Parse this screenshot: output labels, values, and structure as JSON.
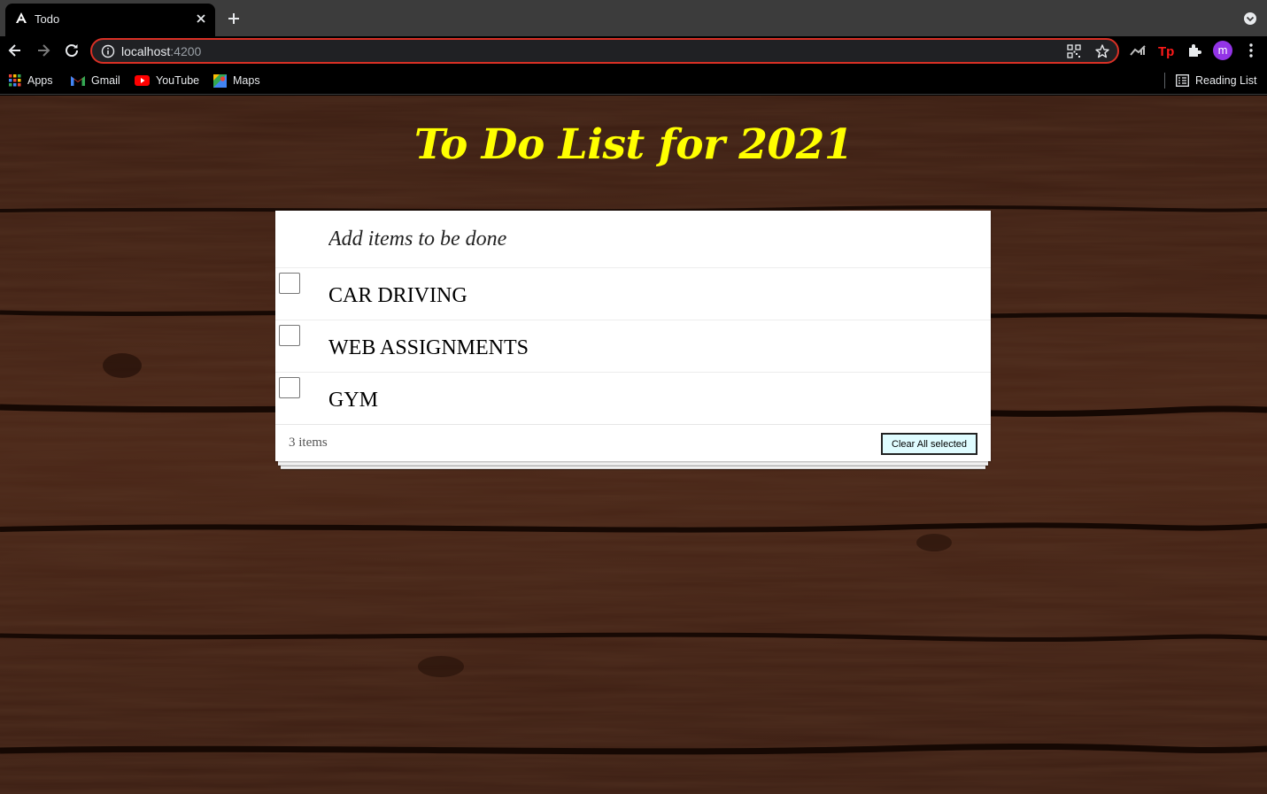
{
  "browser": {
    "tab_title": "Todo",
    "url_host": "localhost",
    "url_port": ":4200",
    "profile_initial": "m",
    "bookmarks": [
      {
        "label": "Apps",
        "icon": "apps-grid-icon"
      },
      {
        "label": "Gmail",
        "icon": "gmail-icon"
      },
      {
        "label": "YouTube",
        "icon": "youtube-icon"
      },
      {
        "label": "Maps",
        "icon": "maps-icon"
      }
    ],
    "reading_list_label": "Reading List"
  },
  "page": {
    "title": "To Do List for 2021",
    "title_color": "#ffff00",
    "background": "dark-wood-texture"
  },
  "todo": {
    "new_placeholder": "Add items to be done",
    "items": [
      {
        "label": "CAR DRIVING",
        "completed": false
      },
      {
        "label": "WEB ASSIGNMENTS",
        "completed": false
      },
      {
        "label": "GYM",
        "completed": false
      }
    ],
    "count_text": "3 items",
    "clear_label": "Clear All selected",
    "clear_button_color": "#dffcff"
  }
}
